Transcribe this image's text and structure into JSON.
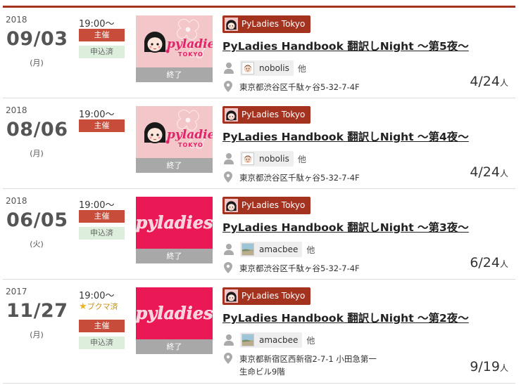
{
  "events": [
    {
      "year": "2018",
      "date": "09/03",
      "weekday": "(月)",
      "time": "19:00〜",
      "bookmark": "",
      "badges": [
        "主催",
        "申込済"
      ],
      "thumb_style": "tokyo",
      "status": "終了",
      "group": "PyLadies Tokyo",
      "title": "PyLadies Handbook 翻訳しNight 〜第5夜〜",
      "member": "nobolis",
      "member_avatar": "face",
      "others": "他",
      "location_lines": [
        "東京都渋谷区千駄ヶ谷5-32-7-4F"
      ],
      "count": "4/24",
      "count_unit": "人"
    },
    {
      "year": "2018",
      "date": "08/06",
      "weekday": "(月)",
      "time": "19:00〜",
      "bookmark": "",
      "badges": [
        "主催"
      ],
      "thumb_style": "tokyo",
      "status": "終了",
      "group": "PyLadies Tokyo",
      "title": "PyLadies Handbook 翻訳しNight 〜第4夜〜",
      "member": "nobolis",
      "member_avatar": "face",
      "others": "他",
      "location_lines": [
        "東京都渋谷区千駄ヶ谷5-32-7-4F"
      ],
      "count": "4/24",
      "count_unit": "人"
    },
    {
      "year": "2018",
      "date": "06/05",
      "weekday": "(火)",
      "time": "19:00〜",
      "bookmark": "",
      "badges": [
        "主催",
        "申込済"
      ],
      "thumb_style": "red",
      "status": "終了",
      "group": "PyLadies Tokyo",
      "title": "PyLadies Handbook 翻訳しNight 〜第3夜〜",
      "member": "amacbee",
      "member_avatar": "photo",
      "others": "他",
      "location_lines": [
        "東京都渋谷区千駄ヶ谷5-32-7-4F"
      ],
      "count": "6/24",
      "count_unit": "人"
    },
    {
      "year": "2017",
      "date": "11/27",
      "weekday": "(月)",
      "time": "19:00〜",
      "bookmark": "ブクマ済",
      "badges": [
        "主催",
        "申込済"
      ],
      "thumb_style": "red",
      "status": "終了",
      "group": "PyLadies Tokyo",
      "title": "PyLadies Handbook 翻訳しNight 〜第2夜〜",
      "member": "amacbee",
      "member_avatar": "photo",
      "others": "他",
      "location_lines": [
        "東京都新宿区西新宿2-7-1 小田急第一",
        "生命ビル9階"
      ],
      "count": "9/19",
      "count_unit": "人"
    }
  ],
  "logo_text": {
    "pyladies": "pyladies",
    "tokyo": "TOKYO"
  },
  "colors": {
    "accent": "#a3321e",
    "host_badge": "#c74c3a",
    "applied_badge": "#ddeedd",
    "thumb_pink": "#f3c7ca",
    "thumb_red": "#ea1956",
    "ended": "#a8a8a8"
  },
  "icons": {
    "member": "person-icon",
    "location": "map-pin-icon",
    "bookmark": "star-icon"
  }
}
